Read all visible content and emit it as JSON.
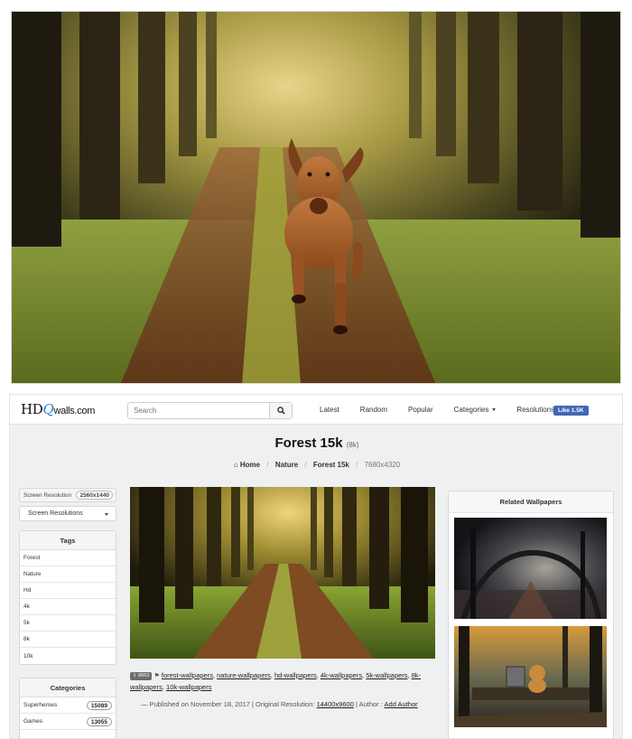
{
  "header": {
    "logo_prefix": "HD",
    "logo_q": "Q",
    "logo_suffix": "walls.com"
  },
  "search": {
    "placeholder": "Search"
  },
  "nav": {
    "links": [
      "Latest",
      "Random",
      "Popular",
      "Categories",
      "Resolutions"
    ],
    "fb_like": "Like 1.5K"
  },
  "page": {
    "title": "Forest 15k",
    "count": "(8k)",
    "breadcrumb": [
      "Home",
      "Nature",
      "Forest 15k",
      "7680x4320"
    ]
  },
  "sidebar": {
    "screen_resolution_label": "Screen Resolution",
    "screen_resolution_value": "2560x1440",
    "resolutions_dropdown": "Screen Resolutions",
    "tags_title": "Tags",
    "tags": [
      "Forest",
      "Nature",
      "Hd",
      "4k",
      "5k",
      "8k",
      "10k"
    ],
    "categories_title": "Categories",
    "categories": [
      {
        "name": "Superheroes",
        "count": "15089"
      },
      {
        "name": "Games",
        "count": "13055"
      }
    ]
  },
  "meta": {
    "downloads": "8663",
    "tag_links": [
      "forest-wallpapers",
      "nature-wallpapers",
      "hd-wallpapers",
      "4k-wallpapers",
      "5k-wallpapers",
      "8k-wallpapers",
      "10k-wallpapers"
    ],
    "published_prefix": "— Published on November 18, 2017 | Original Resolution:",
    "original_resolution": "14400x9600",
    "author_prefix": "| Author :",
    "author": "Add Author"
  },
  "related": {
    "title": "Related Wallpapers"
  },
  "colors": {
    "accent": "#3d7ec9",
    "fb": "#4267b2",
    "panel_bg": "#eef0f1"
  }
}
